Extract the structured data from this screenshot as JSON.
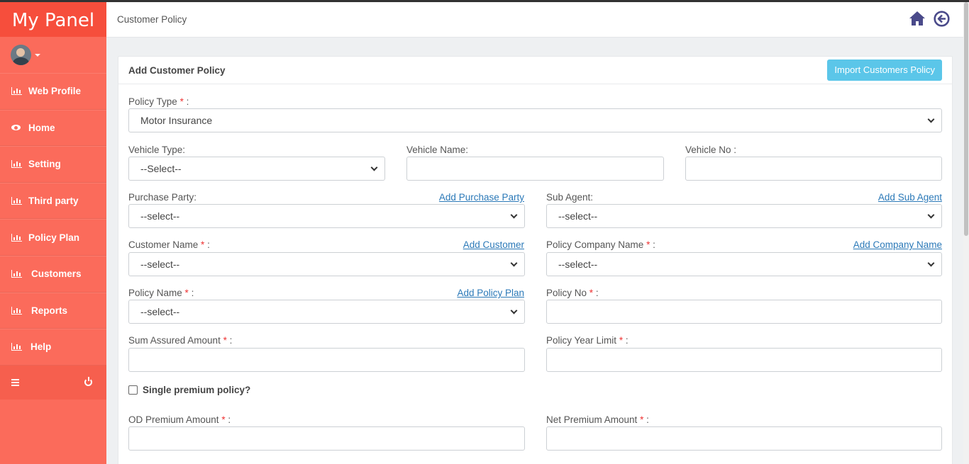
{
  "sidebar": {
    "brand": "My Panel",
    "items": [
      {
        "label": "Web Profile",
        "icon": "bar-chart-icon"
      },
      {
        "label": "Home",
        "icon": "eye-icon"
      },
      {
        "label": "Setting",
        "icon": "bar-chart-icon"
      },
      {
        "label": "Third party",
        "icon": "bar-chart-icon"
      },
      {
        "label": "Policy Plan",
        "icon": "bar-chart-icon"
      },
      {
        "label": "Customers",
        "icon": "bar-chart-icon"
      },
      {
        "label": "Reports",
        "icon": "bar-chart-icon"
      },
      {
        "label": "Help",
        "icon": "bar-chart-icon"
      }
    ]
  },
  "header": {
    "title": "Customer Policy",
    "icons": [
      "home-icon",
      "back-circle-icon"
    ]
  },
  "panel": {
    "title": "Add Customer Policy",
    "import_button": "Import Customers Policy"
  },
  "form": {
    "policy_type": {
      "label": "Policy Type",
      "value": "Motor Insurance"
    },
    "vehicle_type": {
      "label": "Vehicle Type:",
      "value": "--Select--"
    },
    "vehicle_name": {
      "label": "Vehicle Name:",
      "value": ""
    },
    "vehicle_no": {
      "label": "Vehicle No :",
      "value": ""
    },
    "purchase_party": {
      "label": "Purchase Party:",
      "link": "Add Purchase Party",
      "value": "--select--"
    },
    "sub_agent": {
      "label": "Sub Agent:",
      "link": "Add Sub Agent",
      "value": "--select--"
    },
    "customer_name": {
      "label": "Customer Name",
      "link": "Add Customer",
      "value": "--select--"
    },
    "policy_company": {
      "label": "Policy Company Name",
      "link": "Add Company Name",
      "value": "--select--"
    },
    "policy_name": {
      "label": "Policy Name",
      "link": "Add Policy Plan",
      "value": "--select--"
    },
    "policy_no": {
      "label": "Policy No",
      "value": ""
    },
    "sum_assured": {
      "label": "Sum Assured Amount",
      "value": ""
    },
    "policy_year_limit": {
      "label": "Policy Year Limit",
      "value": ""
    },
    "single_premium": {
      "label": "Single premium policy?",
      "checked": false
    },
    "od_premium": {
      "label": "OD Premium Amount",
      "value": ""
    },
    "net_premium": {
      "label": "Net Premium Amount",
      "value": ""
    },
    "required_mark": "*",
    "label_suffix": " :"
  },
  "colors": {
    "sidebar": "#fb6b5b",
    "brand": "#f64e3c",
    "button": "#5bc6e9",
    "link": "#2b79b8",
    "header_icons": "#4a4a8a"
  }
}
